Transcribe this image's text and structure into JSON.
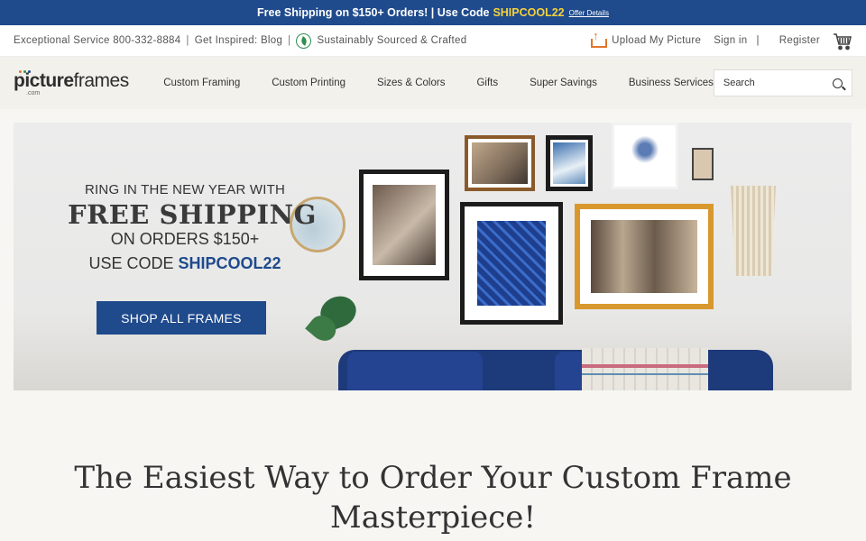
{
  "promo": {
    "text": "Free Shipping on $150+ Orders! | Use Code",
    "code": "SHIPCOOL22",
    "offer_link": "Offer Details"
  },
  "utility": {
    "phone": "Exceptional Service 800-332-8884",
    "blog": "Get Inspired: Blog",
    "sustain": "Sustainably Sourced & Crafted",
    "upload": "Upload My Picture",
    "signin": "Sign in",
    "register": "Register"
  },
  "logo": {
    "bold": "picture",
    "light": "frames",
    "sub": ".com"
  },
  "nav": {
    "items": [
      "Custom Framing",
      "Custom Printing",
      "Sizes & Colors",
      "Gifts",
      "Super Savings",
      "Business Services"
    ],
    "search_placeholder": "Search"
  },
  "hero": {
    "line1": "RING IN THE NEW YEAR WITH",
    "line2": "FREE SHIPPING",
    "line3": "ON ORDERS $150+",
    "line4_prefix": "USE CODE",
    "line4_code": "SHIPCOOL22",
    "cta": "SHOP ALL FRAMES"
  },
  "headline": "The Easiest Way to Order Your Custom Frame Masterpiece!",
  "colors": {
    "brand_blue": "#1f4a8c",
    "promo_code": "#f4d23c",
    "upload_accent": "#e1762d",
    "eco_green": "#2f8f4e"
  },
  "icons": [
    "leaf-icon",
    "upload-icon",
    "cart-icon",
    "search-icon"
  ]
}
